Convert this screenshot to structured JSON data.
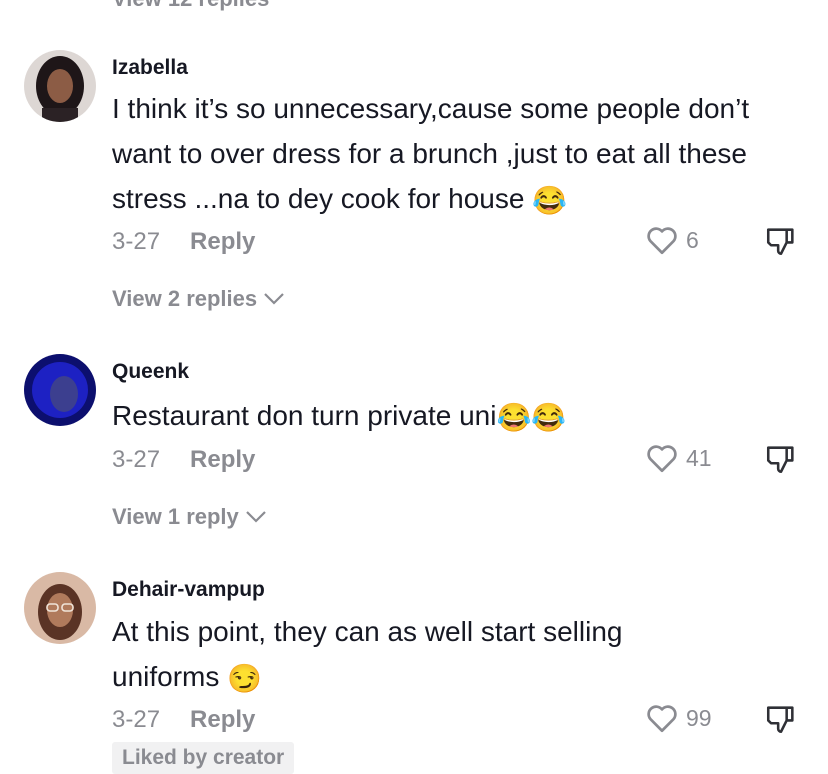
{
  "truncated_top": {
    "label": "View 12 replies"
  },
  "comments": [
    {
      "username": "Izabella",
      "text": "I think it’s so unnecessary,cause some people don’t want to over dress for a brunch ,just to eat all these stress ...na to dey cook for house",
      "emoji_suffix": "😂",
      "date": "3-27",
      "reply_label": "Reply",
      "likes": "6",
      "view_replies": "View 2 replies",
      "avatar_color": "#3a3135"
    },
    {
      "username": "Queenk",
      "text": "Restaurant don turn private uni",
      "emoji_suffix": "😂😂",
      "date": "3-27",
      "reply_label": "Reply",
      "likes": "41",
      "view_replies": "View 1 reply",
      "avatar_color": "#1b1fa8"
    },
    {
      "username": "Dehair-vampup",
      "text": "At this point, they can as well start selling uniforms",
      "emoji_suffix": "😏",
      "date": "3-27",
      "reply_label": "Reply",
      "likes": "99",
      "badge": "Liked by creator",
      "avatar_color": "#a86e55"
    }
  ],
  "colors": {
    "text_primary": "#161823",
    "text_secondary": "#8a8b91",
    "badge_bg": "#f1f1f2"
  }
}
